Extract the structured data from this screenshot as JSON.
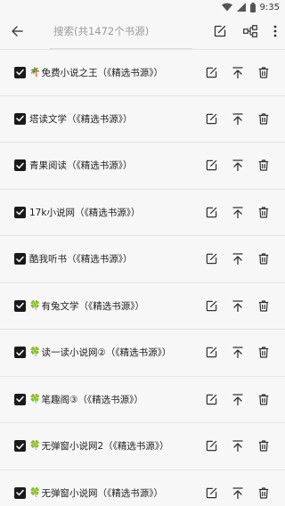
{
  "status": {
    "time": "9:35"
  },
  "search": {
    "placeholder": "搜索(共1472个书源)",
    "value": ""
  },
  "icons": {
    "back": "arrow-back-icon",
    "select": "edit-check-icon",
    "group": "group-tree-icon",
    "more": "more-vert-icon",
    "edit": "edit-icon",
    "top": "arrow-to-top-icon",
    "delete": "trash-icon"
  },
  "sources": [
    {
      "emoji": "🌴",
      "label": "免费小说之王（《精选书源》）"
    },
    {
      "emoji": "",
      "label": "塔读文学（《精选书源》）"
    },
    {
      "emoji": "",
      "label": "青果阅读（《精选书源》）"
    },
    {
      "emoji": "",
      "label": "17k小说网（《精选书源》）"
    },
    {
      "emoji": "",
      "label": "酷我听书（《精选书源》）"
    },
    {
      "emoji": "🍀",
      "label": "有兔文学（《精选书源》）"
    },
    {
      "emoji": "🍀",
      "label": "读一读小说网②（《精选书源》）"
    },
    {
      "emoji": "🍀",
      "label": "笔趣阁③（《精选书源》）"
    },
    {
      "emoji": "🍀",
      "label": "无弹窗小说网2（《精选书源》）"
    },
    {
      "emoji": "🍀",
      "label": "无弹窗小说网（《精选书源》）"
    }
  ]
}
